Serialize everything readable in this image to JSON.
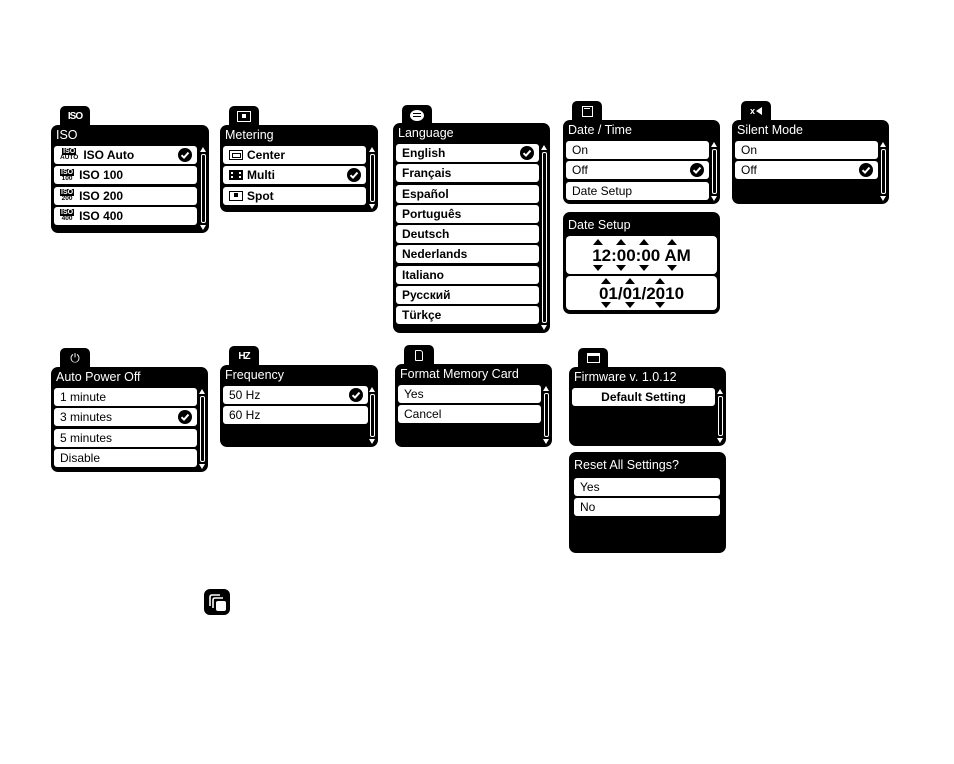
{
  "panels": {
    "iso": {
      "tab_icon": "iso-icon",
      "tab_text": "ISO",
      "title": "ISO",
      "items": [
        {
          "icon_top": "ISO",
          "icon_bottom": "AUTO",
          "label": "ISO Auto",
          "selected": true
        },
        {
          "icon_top": "ISO",
          "icon_bottom": "100",
          "label": "ISO 100",
          "selected": false
        },
        {
          "icon_top": "ISO",
          "icon_bottom": "200",
          "label": "ISO 200",
          "selected": false
        },
        {
          "icon_top": "ISO",
          "icon_bottom": "400",
          "label": "ISO 400",
          "selected": false
        }
      ]
    },
    "metering": {
      "tab_icon": "metering-icon",
      "title": "Metering",
      "items": [
        {
          "icon": "center-metering-icon",
          "label": "Center",
          "selected": false
        },
        {
          "icon": "multi-metering-icon",
          "label": "Multi",
          "selected": true
        },
        {
          "icon": "spot-metering-icon",
          "label": "Spot",
          "selected": false
        }
      ]
    },
    "language": {
      "tab_icon": "speech-bubble-icon",
      "title": "Language",
      "items": [
        {
          "label": "English",
          "selected": true
        },
        {
          "label": "Français",
          "selected": false
        },
        {
          "label": "Español",
          "selected": false
        },
        {
          "label": "Português",
          "selected": false
        },
        {
          "label": "Deutsch",
          "selected": false
        },
        {
          "label": "Nederlands",
          "selected": false
        },
        {
          "label": "Italiano",
          "selected": false
        },
        {
          "label": "Русский",
          "selected": false
        },
        {
          "label": "Türkçe",
          "selected": false
        }
      ]
    },
    "date_time": {
      "tab_icon": "calendar-icon",
      "title": "Date / Time",
      "items": [
        {
          "label": "On",
          "selected": false
        },
        {
          "label": "Off",
          "selected": true
        },
        {
          "label": "Date Setup",
          "selected": false
        }
      ]
    },
    "date_setup": {
      "title": "Date Setup",
      "time": "12:00:00 AM",
      "date": "01/01/2010"
    },
    "silent_mode": {
      "tab_icon": "speaker-mute-icon",
      "tab_text": "x",
      "title": "Silent Mode",
      "items": [
        {
          "label": "On",
          "selected": false
        },
        {
          "label": "Off",
          "selected": true
        }
      ]
    },
    "auto_power_off": {
      "tab_icon": "power-icon",
      "tab_text": "⏻",
      "title": "Auto Power Off",
      "items": [
        {
          "label": "1 minute",
          "selected": false
        },
        {
          "label": "3 minutes",
          "selected": true
        },
        {
          "label": "5 minutes",
          "selected": false
        },
        {
          "label": "Disable",
          "selected": false
        }
      ]
    },
    "frequency": {
      "tab_icon": "hz-icon",
      "tab_text": "HZ",
      "title": "Frequency",
      "items": [
        {
          "label": "50 Hz",
          "selected": true
        },
        {
          "label": "60 Hz",
          "selected": false
        }
      ]
    },
    "format_memory_card": {
      "tab_icon": "sd-card-icon",
      "title": "Format Memory Card",
      "items": [
        {
          "label": "Yes",
          "selected": false
        },
        {
          "label": "Cancel",
          "selected": false
        }
      ]
    },
    "firmware": {
      "tab_icon": "window-icon",
      "title": "Firmware v. 1.0.12",
      "items": [
        {
          "label": "Default Setting",
          "selected": false
        }
      ]
    },
    "reset_all": {
      "title": "Reset All Settings?",
      "items": [
        {
          "label": "Yes",
          "selected": false
        },
        {
          "label": "No",
          "selected": false
        }
      ]
    }
  },
  "footer_icon": "stacked-pages-icon"
}
